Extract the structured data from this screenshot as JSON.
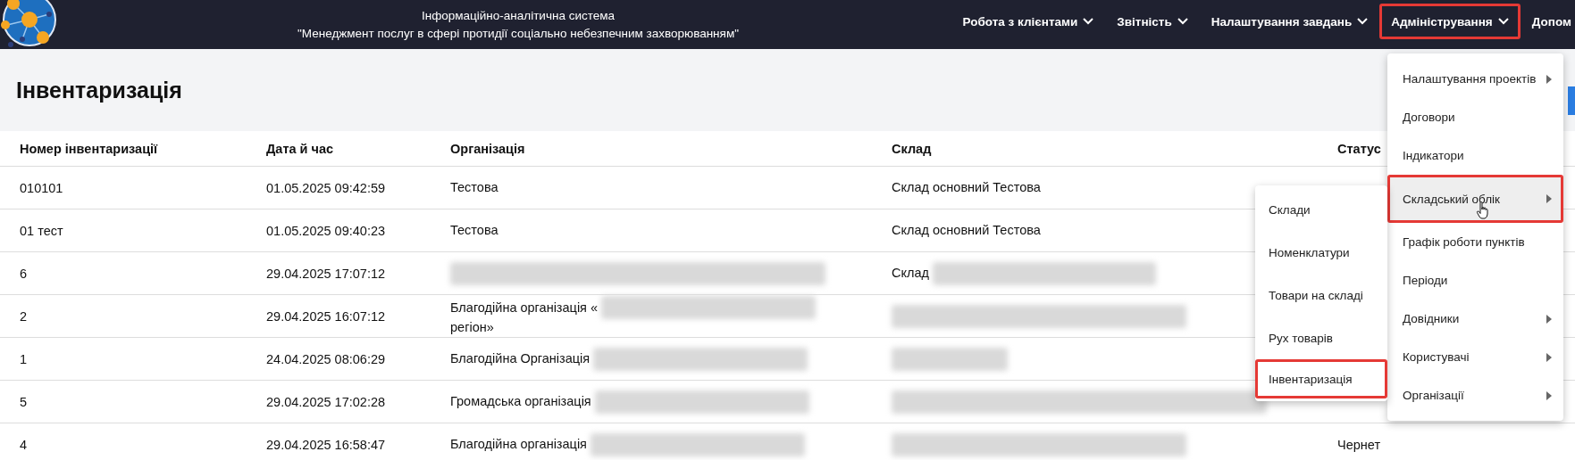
{
  "header": {
    "title_line1": "Інформаційно-аналітична система",
    "title_line2": "\"Менеджмент послуг в сфері протидії соціально небезпечним захворюванням\"",
    "nav": [
      {
        "label": "Робота з клієнтами",
        "highlighted": false
      },
      {
        "label": "Звітність",
        "highlighted": false
      },
      {
        "label": "Налаштування завдань",
        "highlighted": false
      },
      {
        "label": "Адміністрування",
        "highlighted": true
      },
      {
        "label": "Допом",
        "highlighted": false
      }
    ]
  },
  "page": {
    "title": "Інвентаризація"
  },
  "table": {
    "columns": [
      "Номер інвентаризації",
      "Дата й час",
      "Організація",
      "Склад",
      "Статус"
    ],
    "rows": [
      {
        "number": "010101",
        "datetime": "01.05.2025 09:42:59",
        "org": {
          "text": "Тестова",
          "blurred": false
        },
        "warehouse": {
          "text": "Склад основний Тестова",
          "blurred": false
        }
      },
      {
        "number": "01 тест",
        "datetime": "01.05.2025 09:40:23",
        "org": {
          "text": "Тестова",
          "blurred": false
        },
        "warehouse": {
          "text": "Склад основний Тестова",
          "blurred": false
        }
      },
      {
        "number": "6",
        "datetime": "29.04.2025 17:07:12",
        "org": {
          "blurred": true
        },
        "warehouse": {
          "text": "Склад",
          "blurred": true
        }
      },
      {
        "number": "2",
        "datetime": "29.04.2025 16:07:12",
        "org": {
          "text": "Благодійна організація «",
          "blurred": true,
          "continuation": "регіон»"
        },
        "warehouse": {
          "blurred": true
        }
      },
      {
        "number": "1",
        "datetime": "24.04.2025 08:06:29",
        "org": {
          "text": "Благодійна Організація",
          "blurred": true
        },
        "warehouse": {
          "blurred": true
        }
      },
      {
        "number": "5",
        "datetime": "29.04.2025 17:02:28",
        "org": {
          "text": "Громадська організація",
          "blurred": true
        },
        "warehouse": {
          "blurred": true
        }
      },
      {
        "number": "4",
        "datetime": "29.04.2025 16:58:47",
        "org": {
          "text": "Благодійна організація",
          "blurred": true
        },
        "warehouse": {
          "blurred": true
        },
        "status": "Чернет"
      }
    ]
  },
  "admin_menu": [
    {
      "label": "Налаштування проектів",
      "has_submenu": true,
      "highlighted": false
    },
    {
      "label": "Договори",
      "has_submenu": false,
      "highlighted": false
    },
    {
      "label": "Індикатори",
      "has_submenu": false,
      "highlighted": false
    },
    {
      "label": "Складський облік",
      "has_submenu": true,
      "highlighted": true
    },
    {
      "label": "Графік роботи пунктів",
      "has_submenu": false,
      "highlighted": false
    },
    {
      "label": "Періоди",
      "has_submenu": false,
      "highlighted": false
    },
    {
      "label": "Довідники",
      "has_submenu": true,
      "highlighted": false
    },
    {
      "label": "Користувачі",
      "has_submenu": true,
      "highlighted": false
    },
    {
      "label": "Організації",
      "has_submenu": true,
      "highlighted": false
    }
  ],
  "warehouse_submenu": [
    {
      "label": "Склади",
      "highlighted": false
    },
    {
      "label": "Номенклатури",
      "highlighted": false
    },
    {
      "label": "Товари на складі",
      "highlighted": false
    },
    {
      "label": "Рух товарів",
      "highlighted": false
    },
    {
      "label": "Інвентаризація",
      "highlighted": true
    }
  ]
}
